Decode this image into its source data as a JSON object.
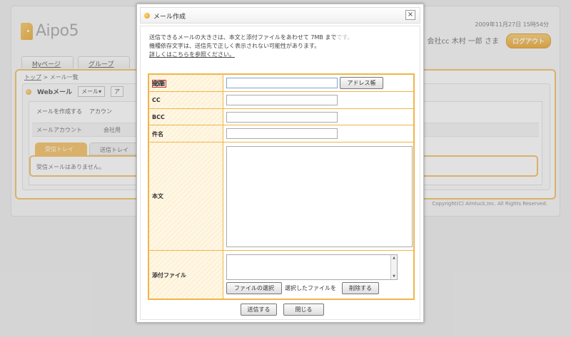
{
  "app": {
    "logo_text": "Aipo5",
    "date": "2009年11月27日 15時54分",
    "user": "会社cc 木村 一郎 さま",
    "logout": "ログアウト",
    "nav_tabs": [
      "Myページ",
      "グループ"
    ],
    "breadcrumb": {
      "home": "トップ",
      "sep": " > ",
      "current": "メール一覧"
    },
    "webmail_title": "Webメール",
    "webmail_menu": "メール▾",
    "webmail_menu2": "ア",
    "links": [
      "メールを作成する",
      "アカウン"
    ],
    "account_label": "メールアカウント",
    "account_value": "会社用",
    "mail_tabs": [
      "受信トレイ",
      "送信トレイ"
    ],
    "inbox_empty": "受信メールはありません。",
    "copyright": "Copyright(C) Aimluck,Inc. All Rights Reserved."
  },
  "dialog": {
    "title": "メール作成",
    "close": "×",
    "notice_line1": "送信できるメールの大きさは、本文と添付ファイルをあわせて 7MB まで",
    "notice_line1_light": "です。",
    "notice_line2": "機種依存文字は、送信先で正しく表示されない可能性があります。",
    "notice_link": "詳しくはこちらを参照ください。",
    "fields": {
      "to_label": "宛先",
      "required": "必須",
      "address_book": "アドレス帳",
      "cc_label": "CC",
      "bcc_label": "BCC",
      "subject_label": "件名",
      "body_label": "本文",
      "attach_label": "添付ファイル",
      "choose_file": "ファイルの選択",
      "selected_file_text": "選択したファイルを",
      "delete": "削除する",
      "scroll_up": "▲",
      "scroll_down": "▼"
    },
    "send": "送信する",
    "close_button": "閉じる"
  },
  "colors": {
    "accent": "#f1b54a",
    "background": "#ececec"
  }
}
